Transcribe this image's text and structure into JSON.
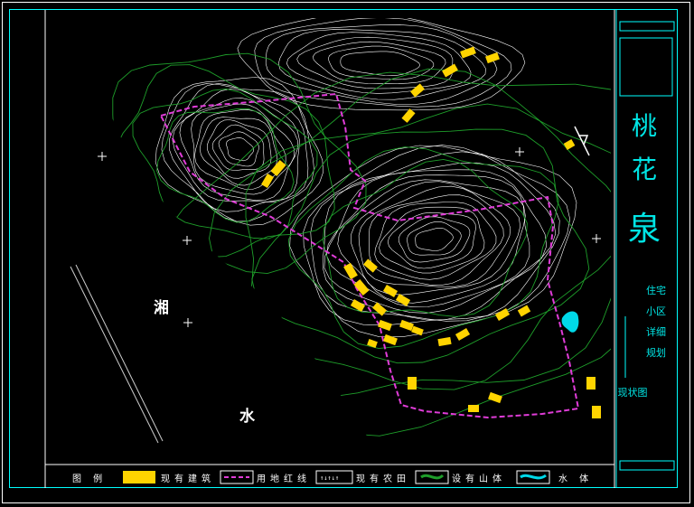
{
  "title_block": {
    "title_chars": [
      "桃",
      "花",
      "泉"
    ],
    "subtitle_lines": [
      "住宅",
      "小区",
      "详细",
      "规划"
    ],
    "drawing_name": "现状图"
  },
  "map": {
    "river_label": "湘",
    "water_label": "水"
  },
  "legend": {
    "heading": "图 例",
    "items": [
      {
        "label": "现有建筑"
      },
      {
        "label": "用地红线"
      },
      {
        "label": "现有农田"
      },
      {
        "label": "设有山体"
      },
      {
        "label": "水 体"
      }
    ]
  },
  "colors": {
    "background": "#000000",
    "building": "#ffd400",
    "boundary": "#e03cd8",
    "contour": "#ffffff",
    "vegetation": "#1e9e2a",
    "frame": "#00ffff",
    "water": "#00d8e8"
  }
}
